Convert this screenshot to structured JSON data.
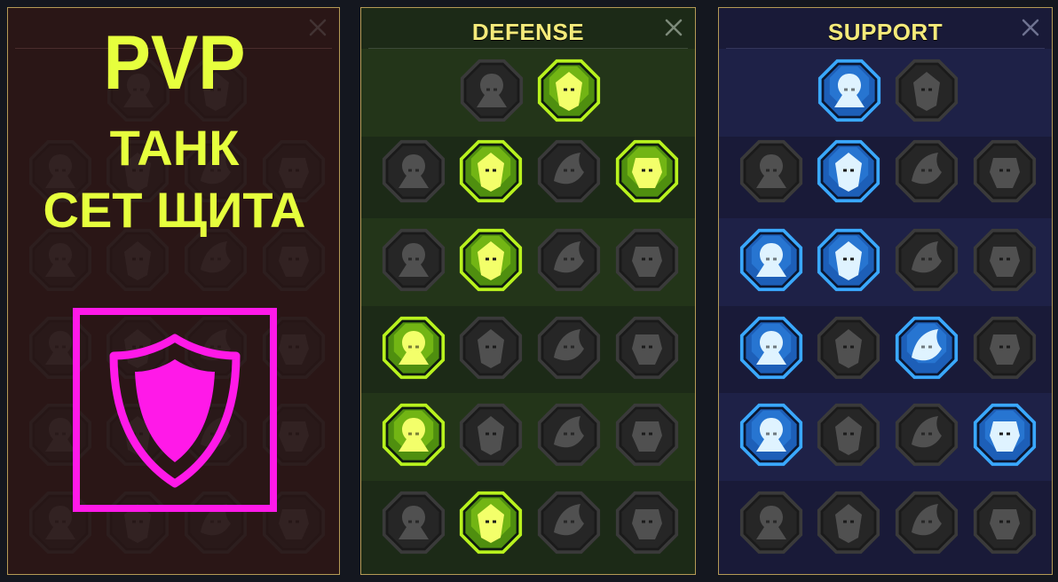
{
  "offense": {
    "overlay_lines": [
      "PVP",
      "ТАНК",
      "СЕТ ЩИТА"
    ],
    "highlight_color": "#ff19e8",
    "overlay_text_color": "#e6ff3d",
    "overlay_icon": "shield-icon"
  },
  "defense": {
    "title": "DEFENSE",
    "close_icon": "close-icon",
    "accent_color": "#b8f21e",
    "tiers": [
      [
        {
          "icon": "crumbling-wall-icon",
          "active": false
        },
        {
          "icon": "raised-fist-icon",
          "active": true
        }
      ],
      [
        {
          "icon": "layered-shield-icon",
          "active": false
        },
        {
          "icon": "anatomical-heart-icon",
          "active": true
        },
        {
          "icon": "stone-warrior-icon",
          "active": false
        },
        {
          "icon": "deflect-blade-icon",
          "active": true
        }
      ],
      [
        {
          "icon": "shadow-figures-icon",
          "active": false
        },
        {
          "icon": "shield-knight-icon",
          "active": true
        },
        {
          "icon": "skull-heart-icon",
          "active": false
        },
        {
          "icon": "hooded-head-icon",
          "active": false
        }
      ],
      [
        {
          "icon": "cheering-crowd-icon",
          "active": true
        },
        {
          "icon": "hourglass-icon",
          "active": false
        },
        {
          "icon": "open-hand-icon",
          "active": false
        },
        {
          "icon": "bull-head-icon",
          "active": false
        }
      ],
      [
        {
          "icon": "dashing-runner-icon",
          "active": true
        },
        {
          "icon": "blood-drops-icon",
          "active": false
        },
        {
          "icon": "spiked-skull-icon",
          "active": false
        },
        {
          "icon": "grabbing-hand-icon",
          "active": false
        }
      ],
      [
        {
          "icon": "beast-warrior-icon",
          "active": false
        },
        {
          "icon": "winged-shield-icon",
          "active": true
        },
        {
          "icon": "bearded-warlord-icon",
          "active": false
        },
        {
          "icon": "flexing-giant-icon",
          "active": false
        }
      ]
    ]
  },
  "support": {
    "title": "SUPPORT",
    "close_icon": "close-icon",
    "accent_color": "#3aa8ff",
    "tiers": [
      [
        {
          "icon": "heart-sparkle-icon",
          "active": true
        },
        {
          "icon": "spiral-rune-icon",
          "active": false
        }
      ],
      [
        {
          "icon": "praying-hands-icon",
          "active": false
        },
        {
          "icon": "aura-shield-icon",
          "active": true
        },
        {
          "icon": "smoking-skull-icon",
          "active": false
        },
        {
          "icon": "draining-hand-icon",
          "active": false
        }
      ],
      [
        {
          "icon": "blessed-figure-icon",
          "active": true
        },
        {
          "icon": "lightning-cycle-icon",
          "active": true
        },
        {
          "icon": "cracked-ground-icon",
          "active": false
        },
        {
          "icon": "twin-shadows-icon",
          "active": false
        }
      ],
      [
        {
          "icon": "chained-heart-icon",
          "active": true
        },
        {
          "icon": "fire-comet-icon",
          "active": false
        },
        {
          "icon": "open-book-icon",
          "active": true
        },
        {
          "icon": "angry-eyes-icon",
          "active": false
        }
      ],
      [
        {
          "icon": "compass-star-icon",
          "active": true
        },
        {
          "icon": "swift-boot-icon",
          "active": false
        },
        {
          "icon": "all-seeing-eye-icon",
          "active": false
        },
        {
          "icon": "voodoo-doll-icon",
          "active": true
        }
      ],
      [
        {
          "icon": "poison-flask-icon",
          "active": false
        },
        {
          "icon": "horned-skull-icon",
          "active": false
        },
        {
          "icon": "winged-fist-icon",
          "active": false
        },
        {
          "icon": "eagle-head-icon",
          "active": false
        }
      ]
    ]
  }
}
